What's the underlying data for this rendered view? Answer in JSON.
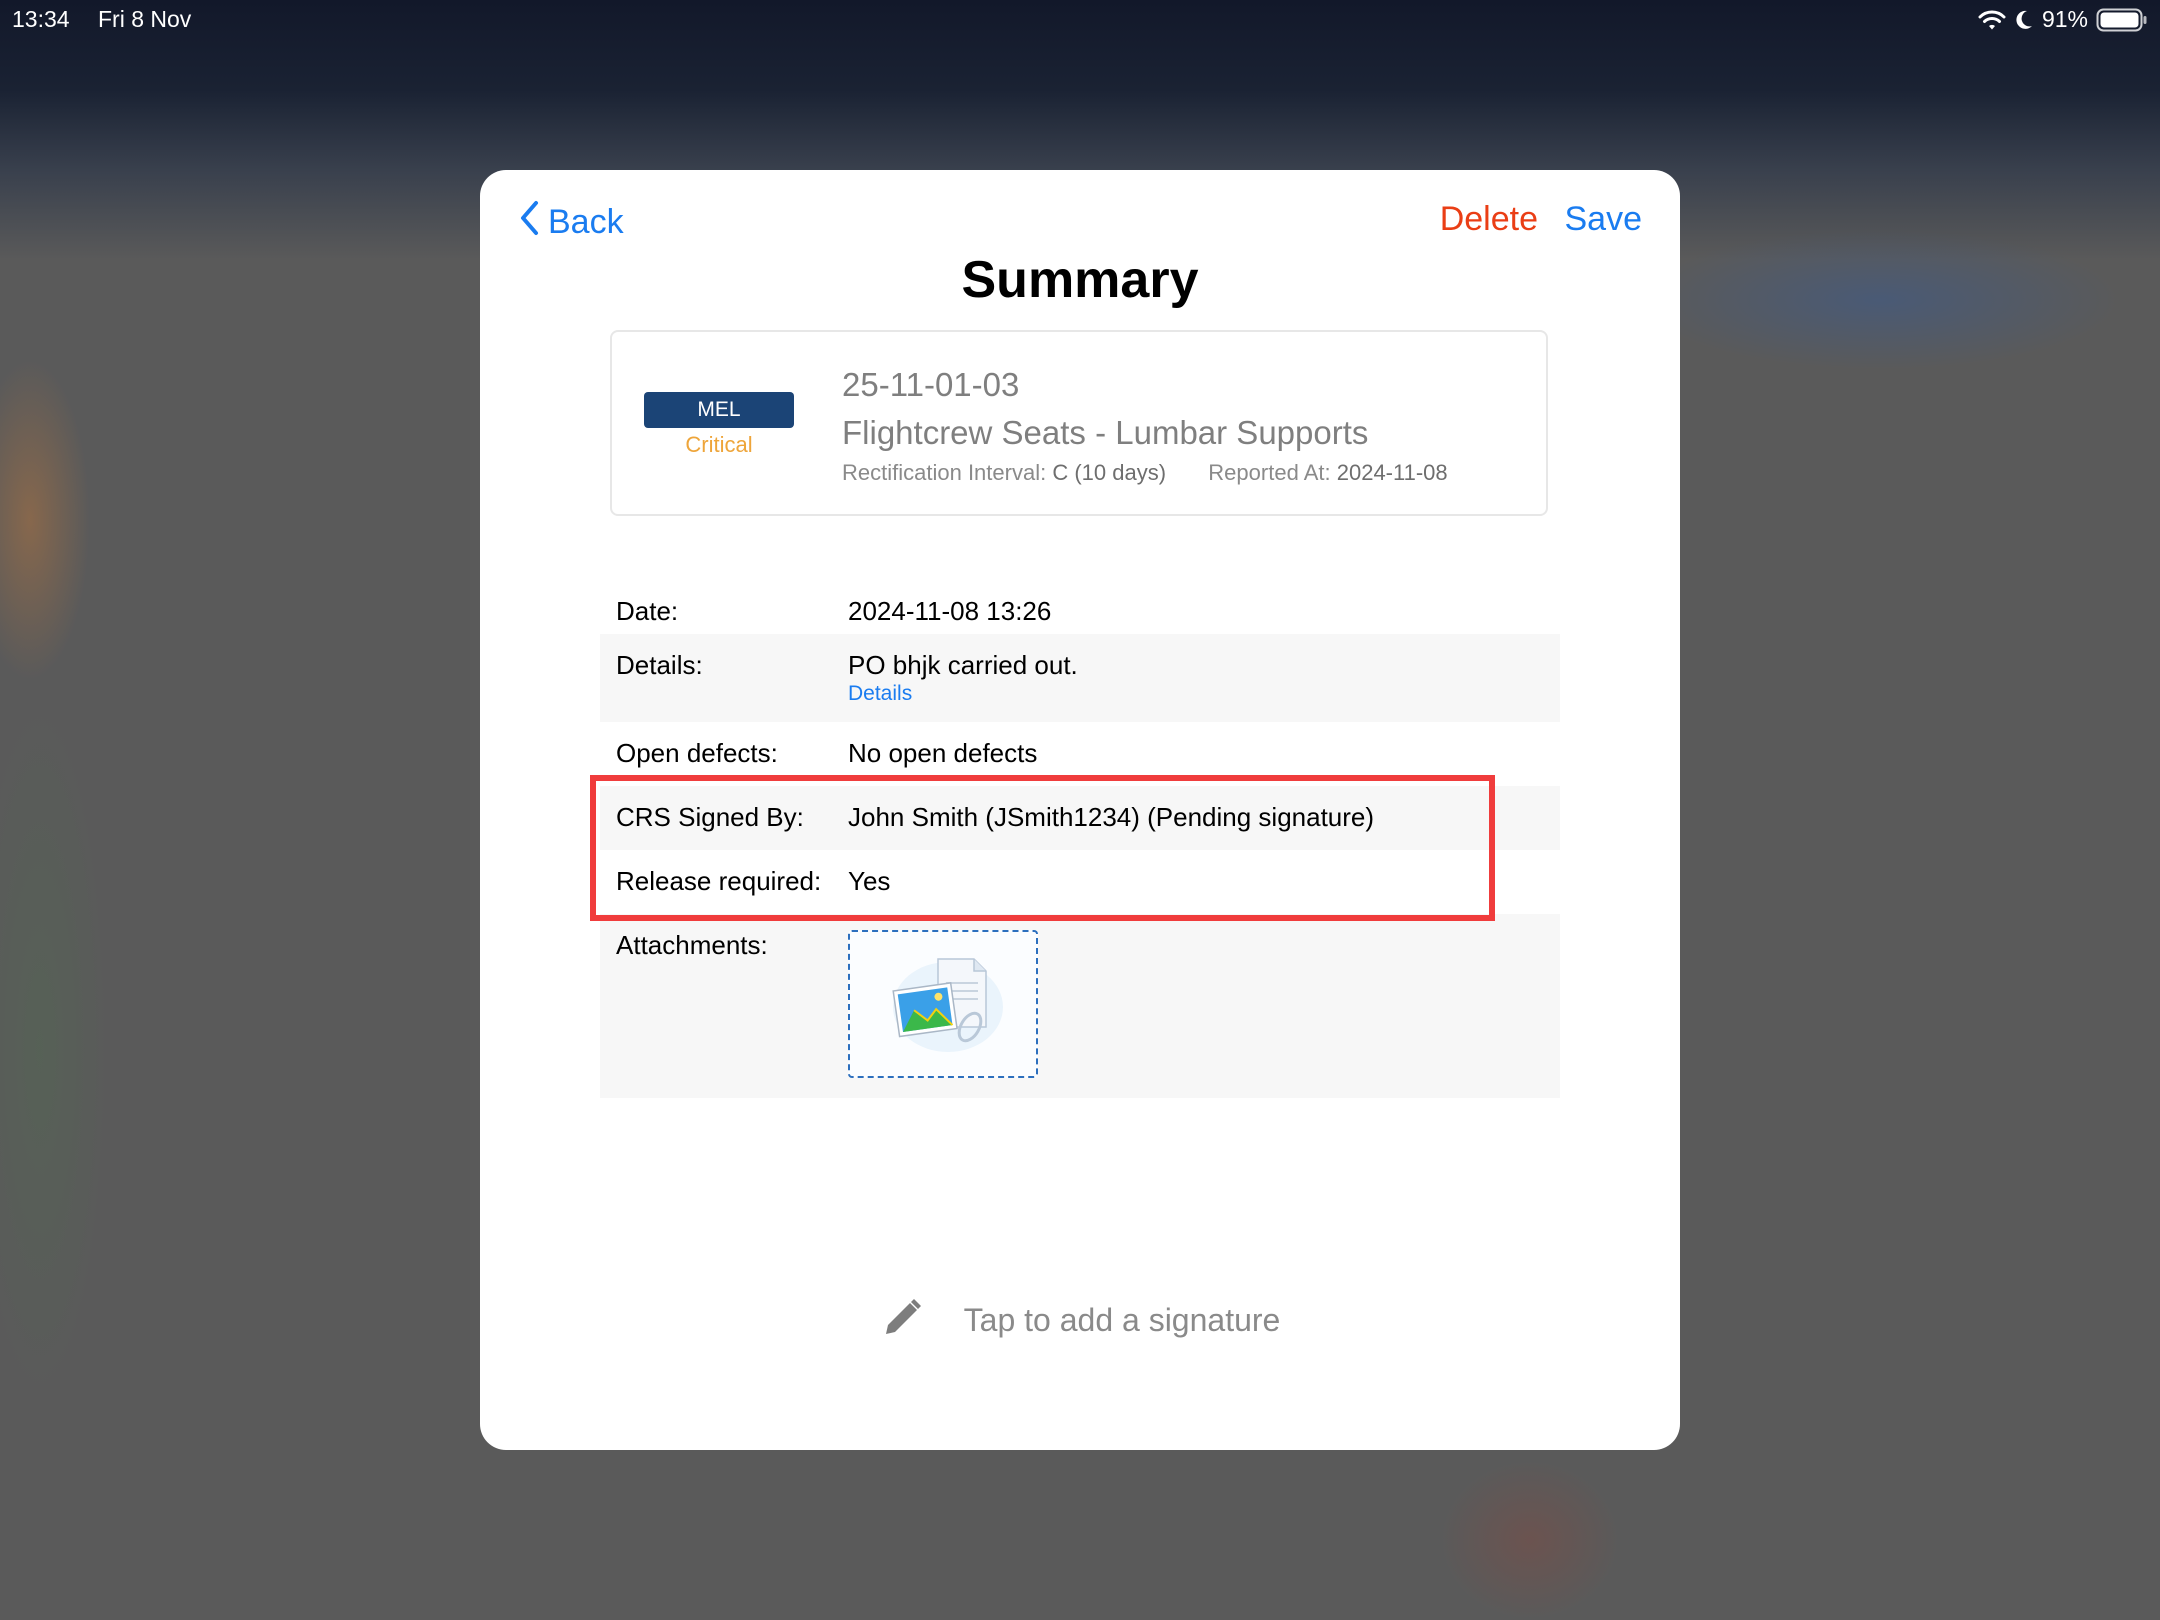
{
  "status_bar": {
    "time": "13:34",
    "date": "Fri 8 Nov",
    "battery": "91%",
    "icons": [
      "wifi-icon",
      "moon-icon",
      "battery-icon"
    ]
  },
  "modal": {
    "back_label": "Back",
    "delete_label": "Delete",
    "save_label": "Save",
    "title": "Summary"
  },
  "defect": {
    "badge": "MEL",
    "category": "Critical",
    "code": "25-11-01-03",
    "title": "Flightcrew Seats - Lumbar Supports",
    "rectification_label": "Rectification Interval:",
    "rectification_value": "C (10 days)",
    "reported_label": "Reported At:",
    "reported_value": "2024-11-08"
  },
  "fields": {
    "date_label": "Date:",
    "date_value": "2024-11-08 13:26",
    "details_label": "Details:",
    "details_value": "PO bhjk carried out.",
    "details_link": "Details",
    "open_defects_label": "Open defects:",
    "open_defects_value": "No open defects",
    "crs_label": "CRS Signed By:",
    "crs_value": "John Smith  (JSmith1234) (Pending signature)",
    "release_label": "Release required:",
    "release_value": "Yes",
    "attachments_label": "Attachments:"
  },
  "signature": {
    "prompt": "Tap to add a signature",
    "icon": "pencil-icon"
  },
  "colors": {
    "accent_blue": "#1a7cf0",
    "delete_red": "#ea3e15",
    "mel_badge": "#1b4476",
    "critical_orange": "#eea53a",
    "highlight_red": "#f03c3c"
  }
}
